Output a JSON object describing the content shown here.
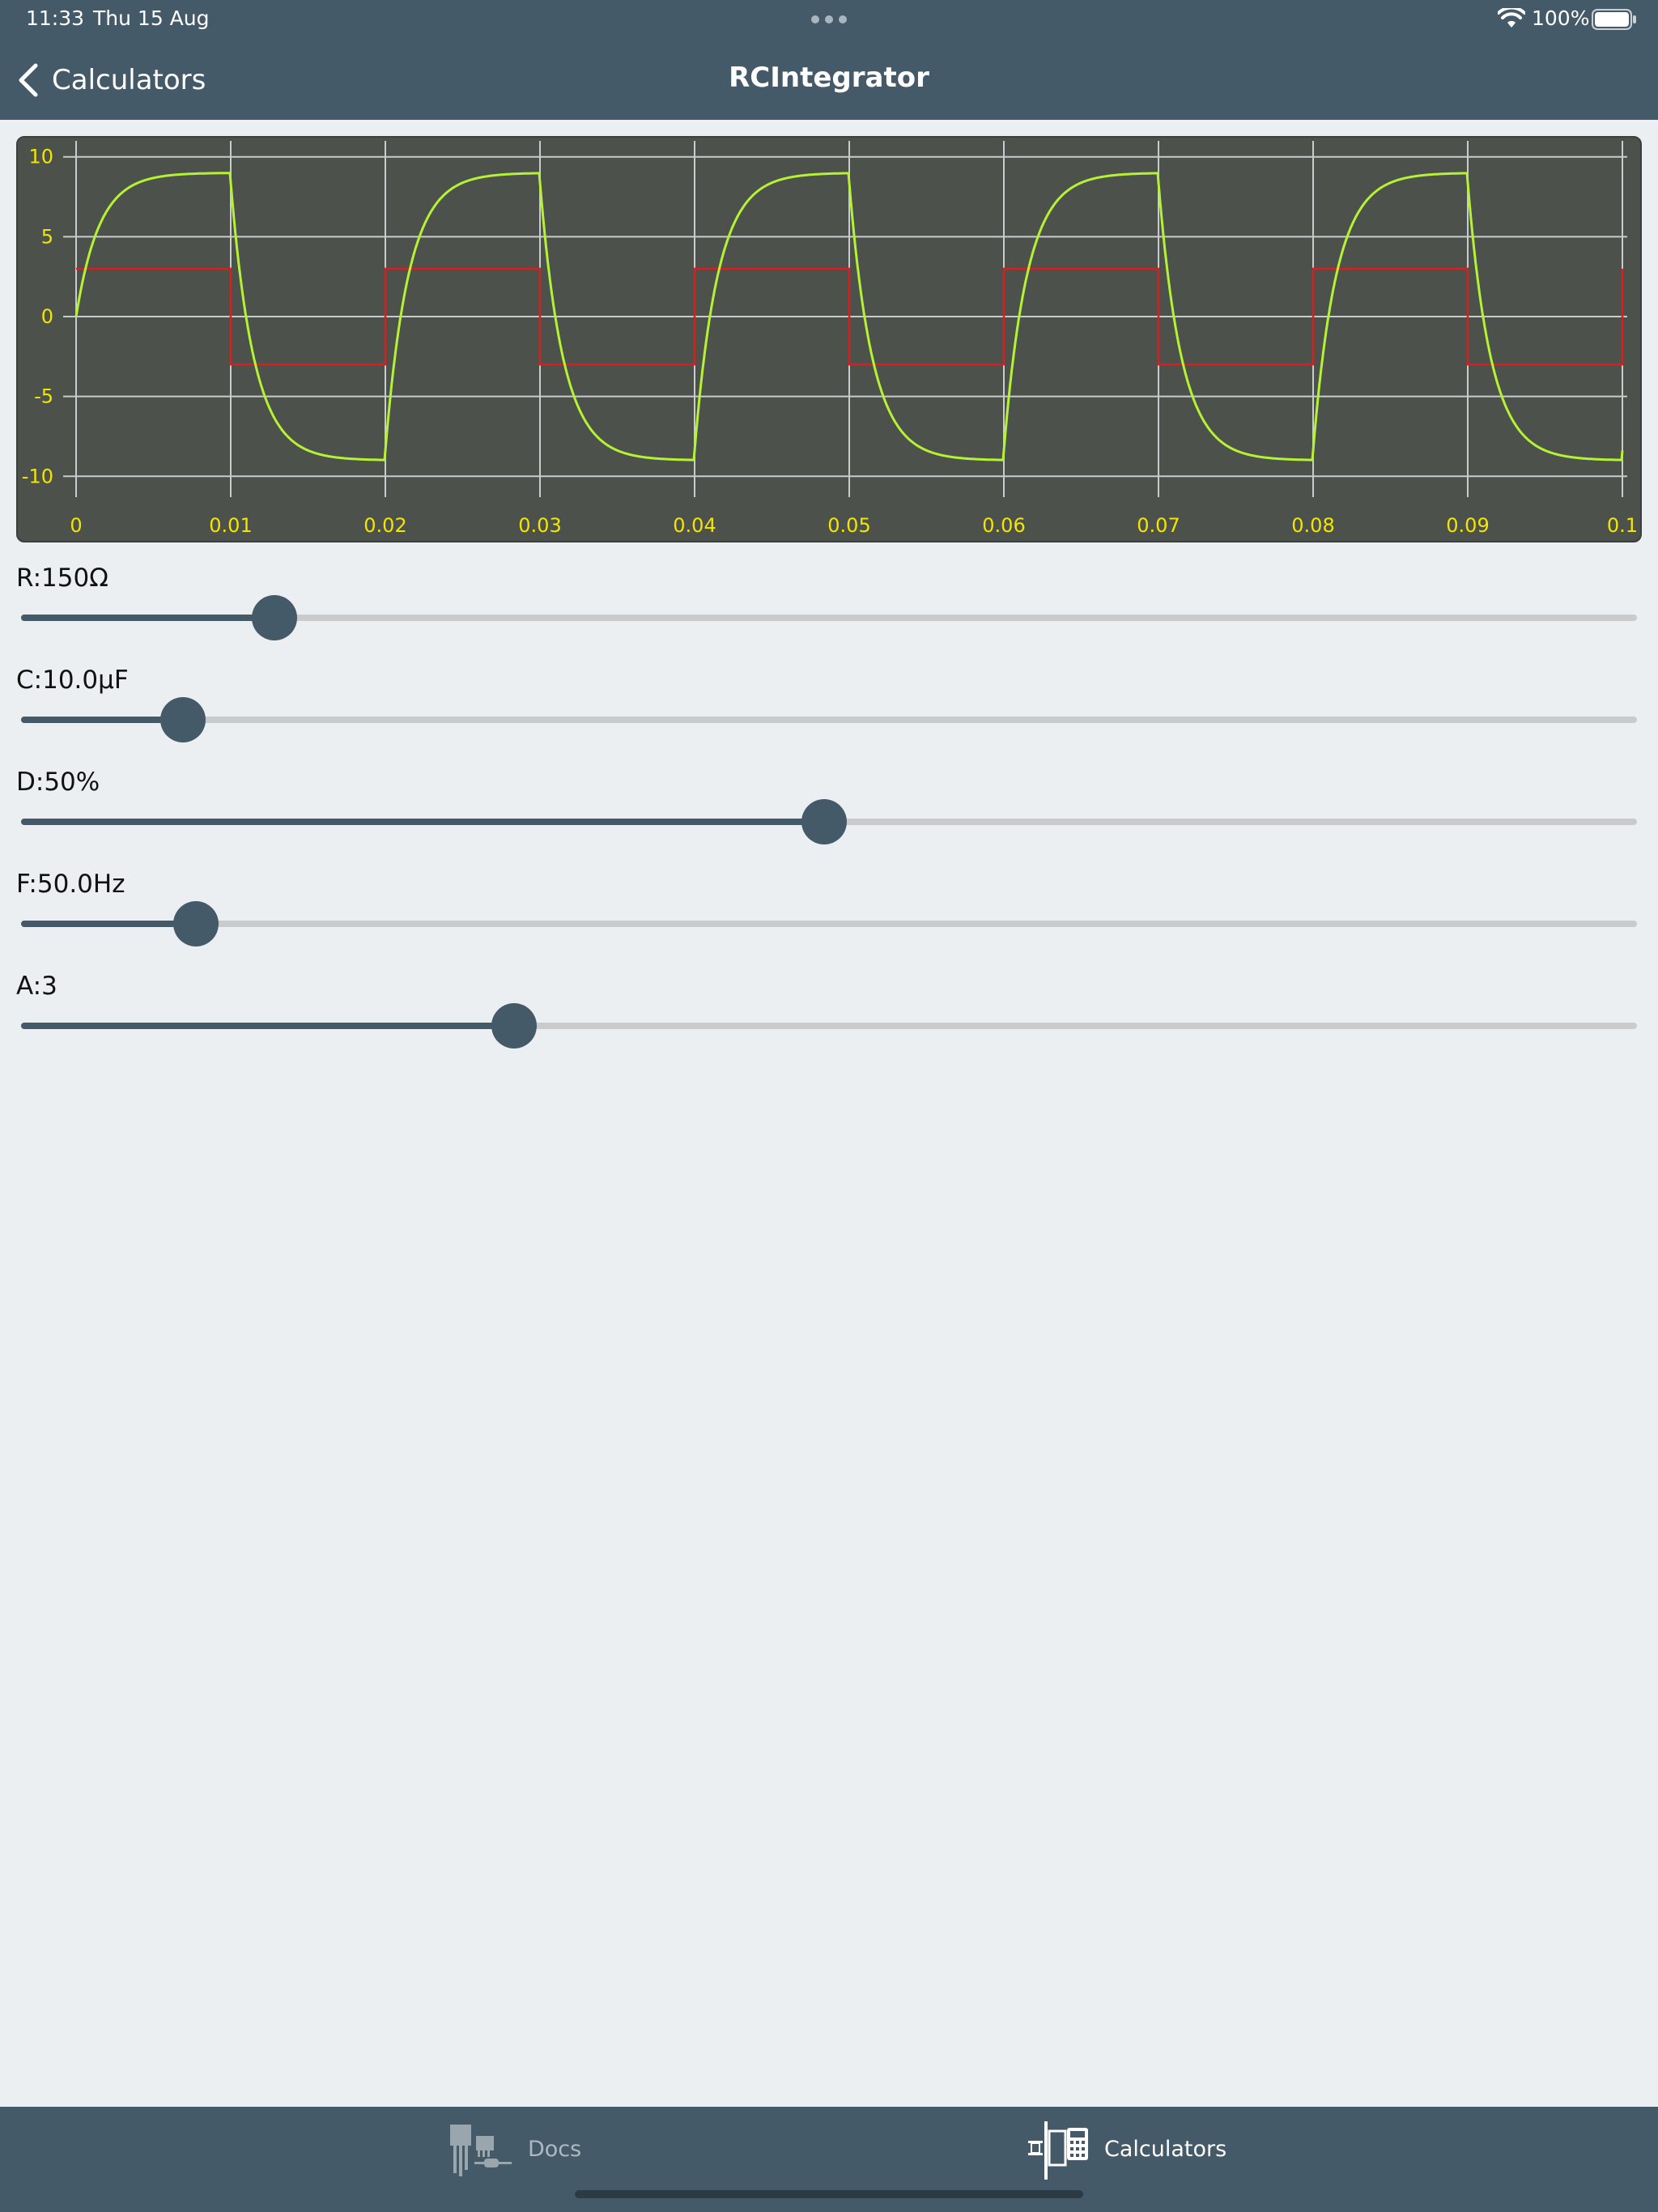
{
  "status_bar": {
    "time": "11:33",
    "date": "Thu 15 Aug",
    "battery": "100%"
  },
  "nav": {
    "back_label": "Calculators",
    "title": "RCIntegrator"
  },
  "colors": {
    "bar": "#455a68",
    "chart_bg": "#4c514c",
    "grid": "#c8cccc",
    "tick_label": "#f2e600",
    "input_series": "#d81f1f",
    "output_series": "#b6f234",
    "slider_fill": "#455a68",
    "slider_track": "#c9cacb"
  },
  "chart_data": {
    "type": "line",
    "x_ticks": [
      "0",
      "0.01",
      "0.02",
      "0.03",
      "0.04",
      "0.05",
      "0.06",
      "0.07",
      "0.08",
      "0.09",
      "0.1"
    ],
    "y_ticks": [
      "10",
      "5",
      "0",
      "-5",
      "-10"
    ],
    "xlim": [
      0,
      0.1
    ],
    "ylim": [
      -11,
      11
    ],
    "grid": true,
    "series": [
      {
        "type": "square_wave",
        "color": "#d81f1f",
        "amplitude": 3,
        "period": 0.02,
        "duty": 0.5
      },
      {
        "type": "rc_response",
        "color": "#b6f234",
        "high": 9.0,
        "low": -9.0,
        "tau": 0.0015,
        "period": 0.02,
        "start": 0
      }
    ]
  },
  "sliders": [
    {
      "label": "R:150Ω",
      "value": 0.157
    },
    {
      "label": "C:10.0μF",
      "value": 0.1
    },
    {
      "label": "D:50%",
      "value": 0.497
    },
    {
      "label": "F:50.0Hz",
      "value": 0.108
    },
    {
      "label": "A:3",
      "value": 0.305
    }
  ],
  "tabs": [
    {
      "label": "Docs",
      "icon": "components-icon",
      "selected": false
    },
    {
      "label": "Calculators",
      "icon": "calculator-icon",
      "selected": true
    }
  ]
}
